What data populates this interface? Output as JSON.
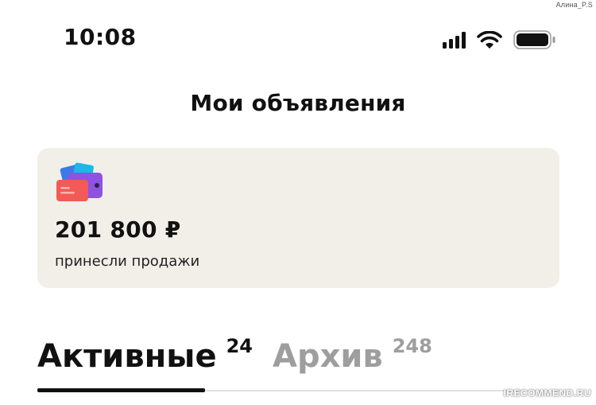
{
  "watermark_user": "Алина_P.S",
  "watermark_site": "IRECOMMEND.RU",
  "status_bar": {
    "time": "10:08",
    "icons": [
      "cellular-signal-icon",
      "wifi-icon",
      "battery-icon"
    ]
  },
  "header": {
    "title": "Мои объявления"
  },
  "sales_card": {
    "amount": "201 800 ₽",
    "caption": "принесли продажи",
    "icon": "wallet-icon"
  },
  "tabs": [
    {
      "label": "Активные",
      "count": "24",
      "active": true
    },
    {
      "label": "Архив",
      "count": "248",
      "active": false
    }
  ],
  "colors": {
    "card_background": "#f2efe9",
    "text_primary": "#111111",
    "text_inactive": "#9e9e9e",
    "tab_track": "#e2e2e2"
  }
}
